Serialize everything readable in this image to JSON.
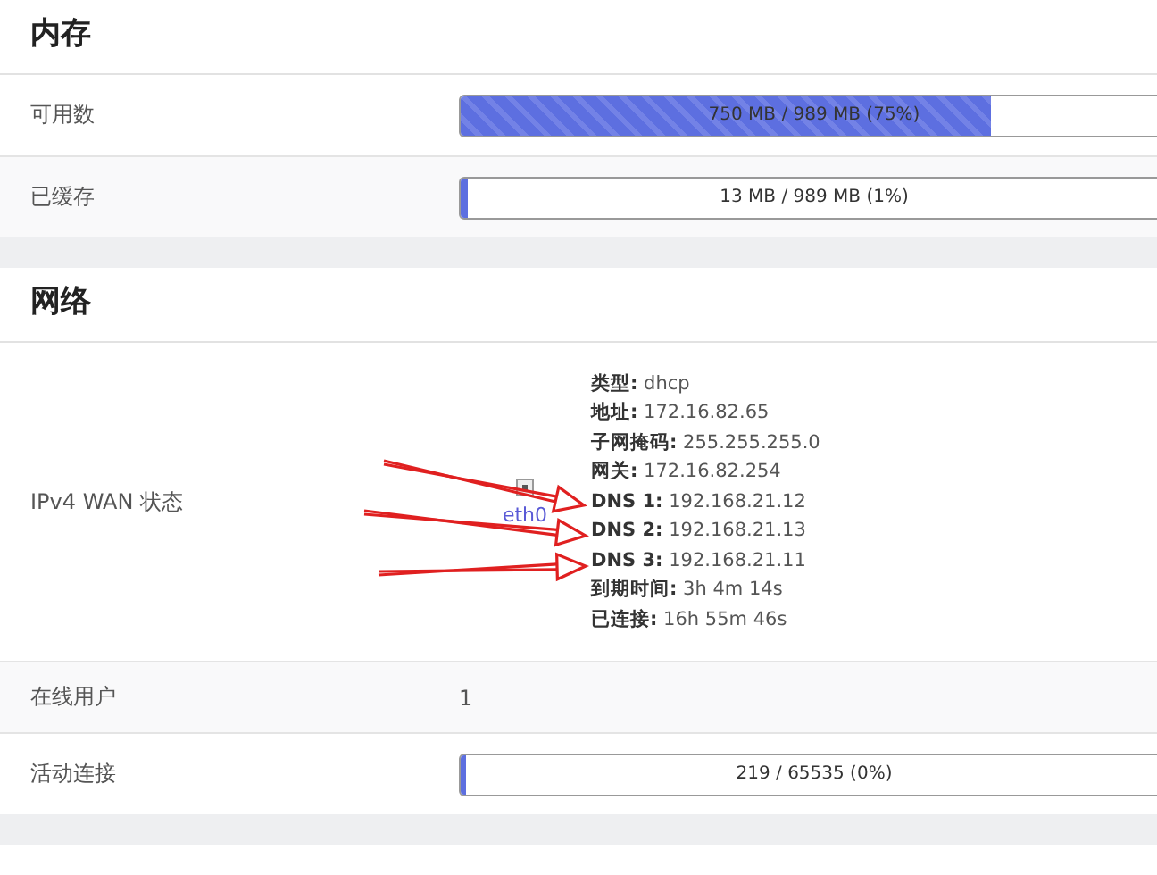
{
  "sections": [
    {
      "title": "内存",
      "rows": [
        {
          "kind": "bar",
          "label": "可用数",
          "reading": "750 MB / 989 MB (75%)",
          "level": 0.75,
          "striped": true
        },
        {
          "kind": "bar",
          "label": "已缓存",
          "reading": "13 MB / 989 MB (1%)",
          "level": 0.01,
          "striped": false
        }
      ]
    },
    {
      "title": "网络",
      "rows": [
        {
          "kind": "wan",
          "label": "IPv4 WAN 状态",
          "interface": "eth0",
          "details": [
            {
              "key": "类型:",
              "value": "dhcp"
            },
            {
              "key": "地址:",
              "value": "172.16.82.65"
            },
            {
              "key": "子网掩码:",
              "value": "255.255.255.0"
            },
            {
              "key": "网关:",
              "value": "172.16.82.254"
            },
            {
              "key": "DNS 1:",
              "value": "192.168.21.12"
            },
            {
              "key": "DNS 2:",
              "value": "192.168.21.13"
            },
            {
              "key": "DNS 3:",
              "value": "192.168.21.11"
            },
            {
              "key": "到期时间:",
              "value": "3h 4m 14s"
            },
            {
              "key": "已连接:",
              "value": "16h 55m 46s"
            }
          ]
        },
        {
          "kind": "text",
          "label": "在线用户",
          "value": "1"
        },
        {
          "kind": "bar",
          "label": "活动连接",
          "reading": "219 / 65535 (0%)",
          "level": 0.0,
          "striped": false
        }
      ]
    }
  ]
}
